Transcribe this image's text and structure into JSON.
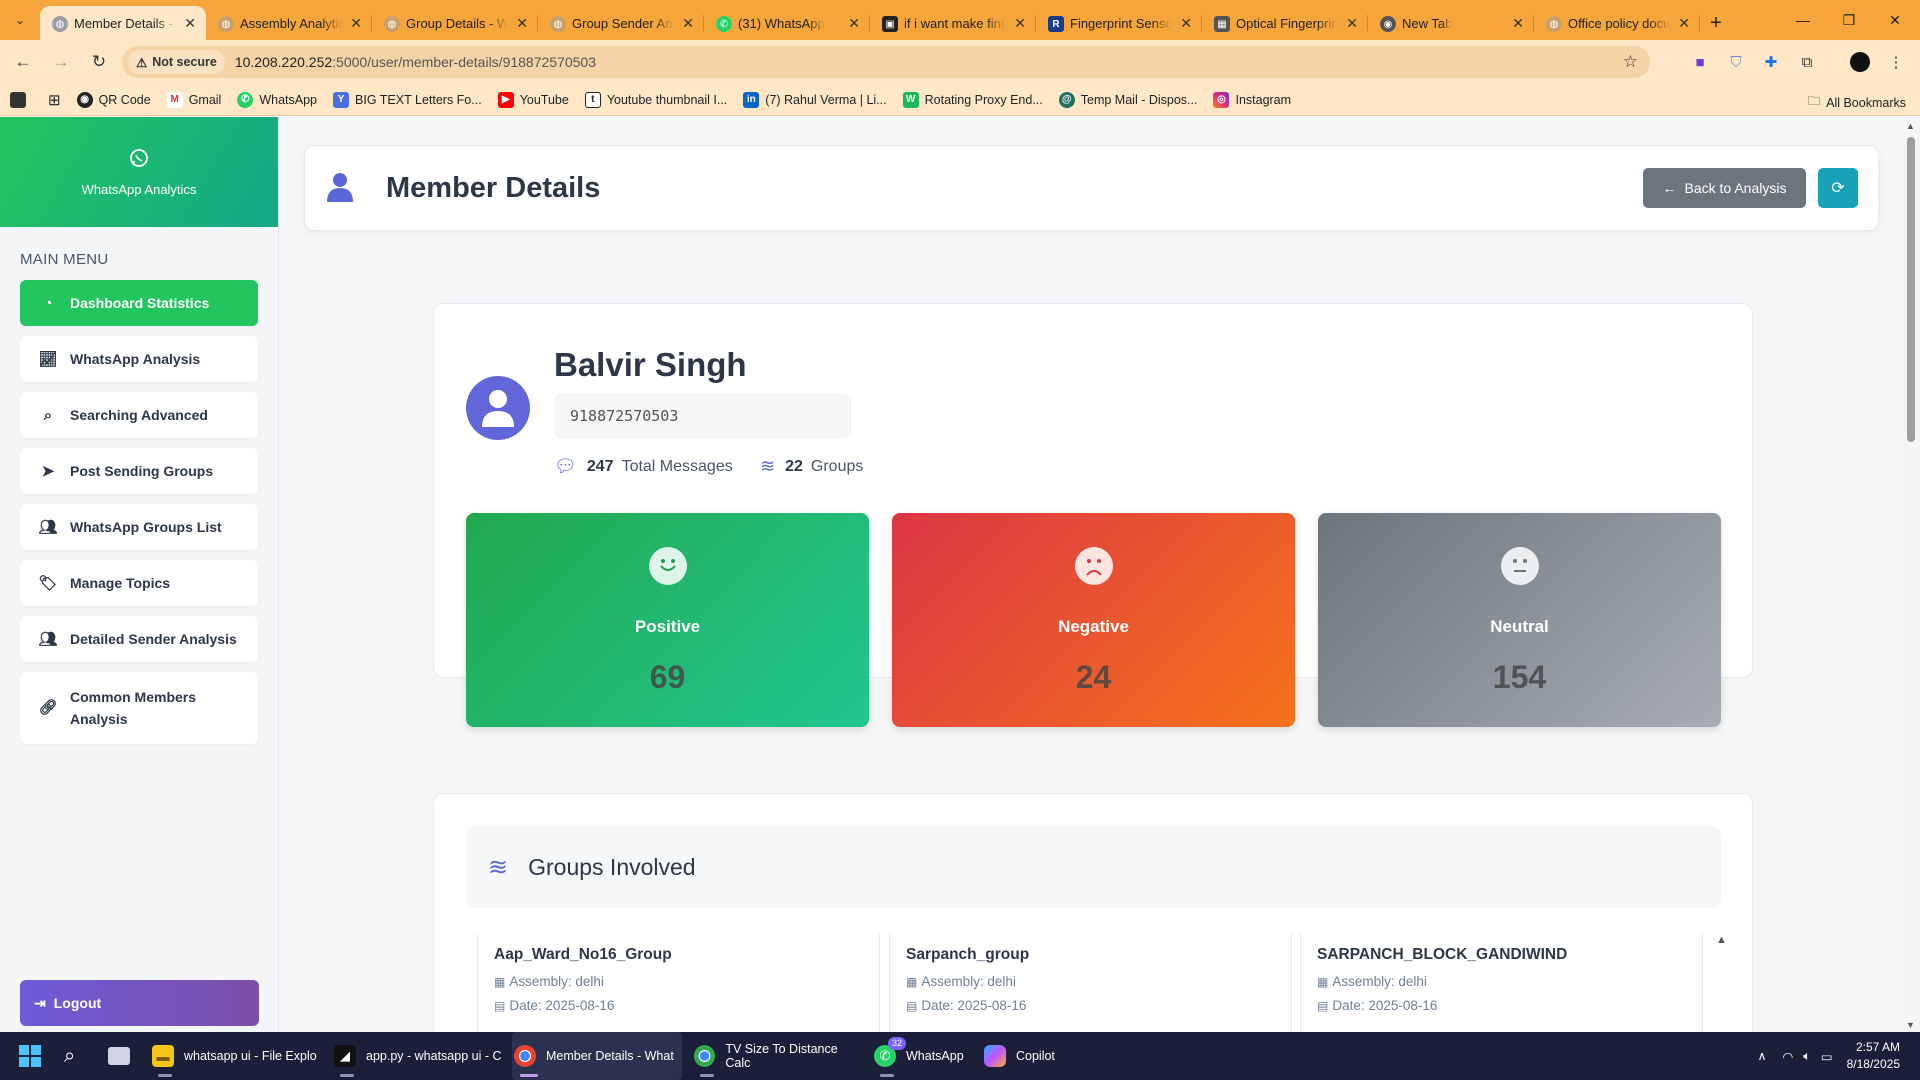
{
  "browser": {
    "tabs": [
      {
        "title": "Member Details - WhatsApp Analytics",
        "active": true,
        "icon": "globe-icon"
      },
      {
        "title": "Assembly Analytics",
        "active": false,
        "icon": "globe-icon"
      },
      {
        "title": "Group Details - WhatsApp",
        "active": false,
        "icon": "globe-icon"
      },
      {
        "title": "Group Sender Analysis",
        "active": false,
        "icon": "globe-icon"
      },
      {
        "title": "(31) WhatsApp",
        "active": false,
        "icon": "whatsapp-icon"
      },
      {
        "title": "if i want make fingerprint",
        "active": false,
        "icon": "tab-site-icon"
      },
      {
        "title": "Fingerprint Sensor",
        "active": false,
        "icon": "r-logo-icon"
      },
      {
        "title": "Optical Fingerprint",
        "active": false,
        "icon": "tab-site-icon"
      },
      {
        "title": "New Tab",
        "active": false,
        "icon": "chrome-icon"
      },
      {
        "title": "Office policy documents",
        "active": false,
        "icon": "globe-icon"
      }
    ],
    "security_label": "Not secure",
    "url_host": "10.208.220.252",
    "url_rest": ":5000/user/member-details/918872570503",
    "bookmarks": [
      {
        "label": "QR Code",
        "icon": "qr-icon"
      },
      {
        "label": "Gmail",
        "icon": "gmail-icon"
      },
      {
        "label": "WhatsApp",
        "icon": "whatsapp-icon"
      },
      {
        "label": "BIG TEXT Letters Fo...",
        "icon": "bigtext-icon"
      },
      {
        "label": "YouTube",
        "icon": "youtube-icon"
      },
      {
        "label": "Youtube thumbnail I...",
        "icon": "thumbnail-icon"
      },
      {
        "label": "(7) Rahul Verma | Li...",
        "icon": "linkedin-icon"
      },
      {
        "label": "Rotating Proxy End...",
        "icon": "proxy-icon"
      },
      {
        "label": "Temp Mail - Dispos...",
        "icon": "tempmail-icon"
      },
      {
        "label": "Instagram",
        "icon": "instagram-icon"
      }
    ],
    "all_bookmarks_label": "All Bookmarks"
  },
  "sidebar": {
    "brand": "WhatsApp Analytics",
    "menu_title": "MAIN MENU",
    "items": [
      {
        "label": "Dashboard Statistics",
        "icon": "dashboard-icon",
        "active": true
      },
      {
        "label": "WhatsApp Analysis",
        "icon": "chart-line-icon"
      },
      {
        "label": "Searching Advanced",
        "icon": "search-icon"
      },
      {
        "label": "Post Sending Groups",
        "icon": "paper-plane-icon"
      },
      {
        "label": "WhatsApp Groups List",
        "icon": "users-icon"
      },
      {
        "label": "Manage Topics",
        "icon": "tags-icon"
      },
      {
        "label": "Detailed Sender Analysis",
        "icon": "users-icon"
      },
      {
        "label": "Common Members Analysis",
        "icon": "link-icon"
      }
    ],
    "logout_label": "Logout"
  },
  "header": {
    "title": "Member Details",
    "back_label": "Back to Analysis"
  },
  "member": {
    "name": "Balvir Singh",
    "phone": "918872570503",
    "total_messages": "247",
    "total_messages_label": "Total Messages",
    "groups": "22",
    "groups_label": "Groups"
  },
  "sentiment": {
    "positive": {
      "label": "Positive",
      "value": "69",
      "color": "#22a94f"
    },
    "negative": {
      "label": "Negative",
      "value": "24",
      "color": "#dc3545"
    },
    "neutral": {
      "label": "Neutral",
      "value": "154",
      "color": "#6c757d"
    }
  },
  "groups_section": {
    "title": "Groups Involved",
    "items": [
      {
        "name": "Aap_Ward_No16_Group",
        "assembly": "Assembly: delhi",
        "date": "Date: 2025-08-16"
      },
      {
        "name": "Sarpanch_group",
        "assembly": "Assembly: delhi",
        "date": "Date: 2025-08-16"
      },
      {
        "name": "SARPANCH_BLOCK_GANDIWIND",
        "assembly": "Assembly: delhi",
        "date": "Date: 2025-08-16"
      }
    ]
  },
  "taskbar": {
    "items": [
      {
        "label": "whatsapp ui - File Explo",
        "icon": "folder-icon"
      },
      {
        "label": "app.py - whatsapp ui - C",
        "icon": "cursor-app-icon"
      },
      {
        "label": "Member Details - What",
        "icon": "chrome-icon"
      },
      {
        "label": "TV Size To Distance Calc",
        "icon": "chrome-icon"
      },
      {
        "label": "WhatsApp",
        "icon": "whatsapp-icon",
        "badge": "32"
      },
      {
        "label": "Copilot",
        "icon": "copilot-icon"
      }
    ],
    "time": "2:57 AM",
    "date": "8/18/2025"
  }
}
